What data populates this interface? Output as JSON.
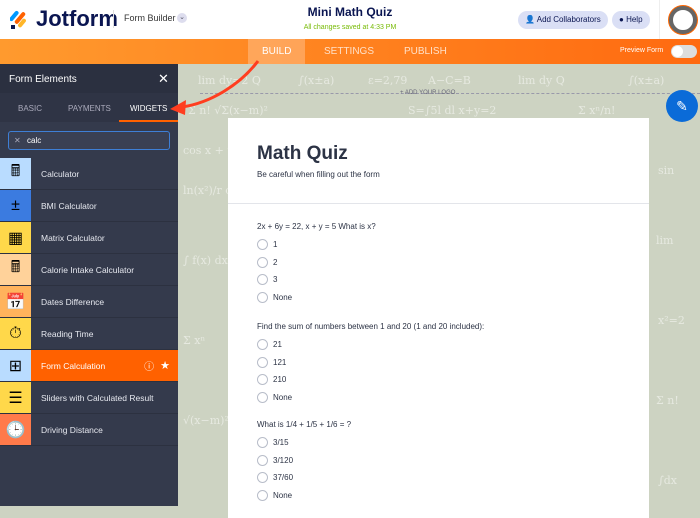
{
  "header": {
    "brand": "Jotform",
    "mode": "Form Builder",
    "title": "Mini Math Quiz",
    "saved": "All changes saved at 4:33 PM",
    "collaborators": "Add Collaborators",
    "help": "Help"
  },
  "nav": {
    "tabs": [
      "BUILD",
      "SETTINGS",
      "PUBLISH"
    ],
    "preview": "Preview Form"
  },
  "sidebar": {
    "title": "Form Elements",
    "tabs": [
      "BASIC",
      "PAYMENTS",
      "WIDGETS"
    ],
    "search": "calc",
    "items": [
      {
        "label": "Calculator",
        "icon": "calculator-icon",
        "color": "#b9dcff"
      },
      {
        "label": "BMI Calculator",
        "icon": "bmi-icon",
        "color": "#3b7be0"
      },
      {
        "label": "Matrix Calculator",
        "icon": "matrix-icon",
        "color": "#ffd84a"
      },
      {
        "label": "Calorie Intake Calculator",
        "icon": "calorie-icon",
        "color": "#ffd29a"
      },
      {
        "label": "Dates Difference",
        "icon": "calendar-icon",
        "color": "#ffb35c"
      },
      {
        "label": "Reading Time",
        "icon": "stopwatch-icon",
        "color": "#ffd84a"
      },
      {
        "label": "Form Calculation",
        "icon": "form-calc-icon",
        "color": "#b9dcff"
      },
      {
        "label": "Sliders with Calculated Result",
        "icon": "sliders-icon",
        "color": "#ffd84a"
      },
      {
        "label": "Driving Distance",
        "icon": "clock-icon",
        "color": "#ff7a4a"
      }
    ]
  },
  "canvas": {
    "add_logo": "+ ADD YOUR LOGO"
  },
  "form": {
    "title": "Math Quiz",
    "subtitle": "Be careful when filling out the form",
    "questions": [
      {
        "label": "2x + 6y = 22, x + y = 5 What is x?",
        "options": [
          "1",
          "2",
          "3",
          "None"
        ]
      },
      {
        "label": "Find the sum of numbers between 1 and 20 (1 and 20 included):",
        "options": [
          "21",
          "121",
          "210",
          "None"
        ]
      },
      {
        "label": "What is 1/4 + 1/5 + 1/6 = ?",
        "options": [
          "3/15",
          "3/120",
          "37/60",
          "None"
        ]
      }
    ]
  }
}
